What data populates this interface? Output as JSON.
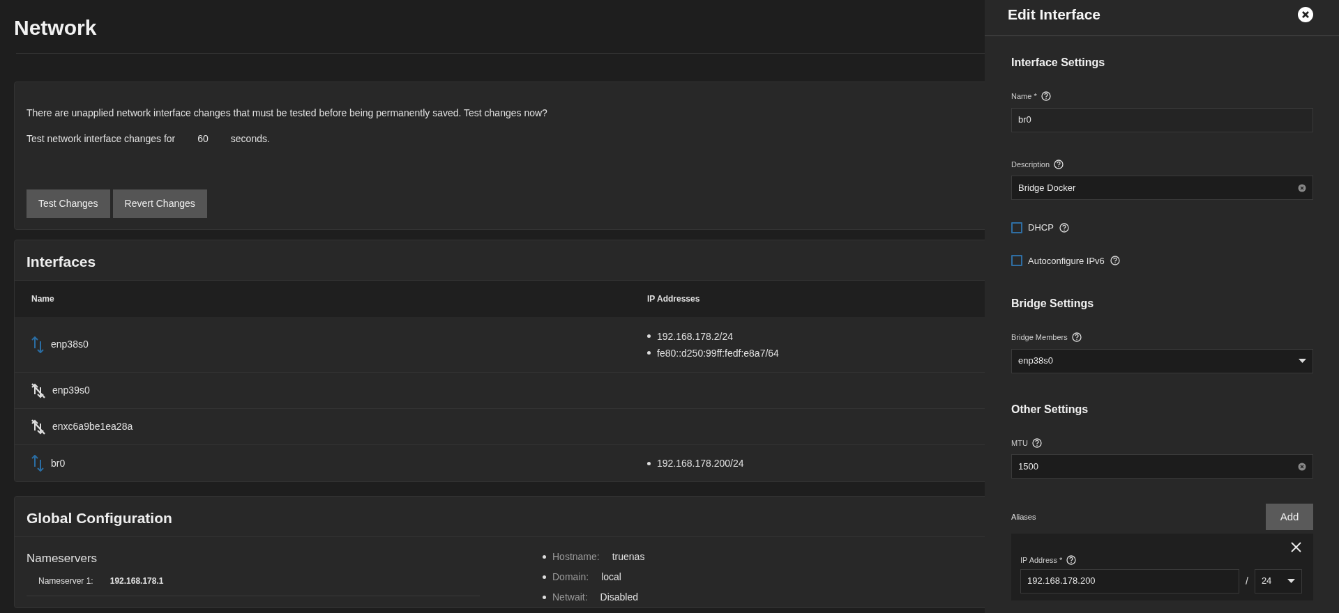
{
  "page": {
    "title": "Network"
  },
  "pending_changes": {
    "message": "There are unapplied network interface changes that must be tested before being permanently saved. Test changes now?",
    "test_prefix": "Test network interface changes for",
    "test_seconds": "60",
    "test_suffix": "seconds.",
    "buttons": [
      "Test Changes",
      "Revert Changes"
    ]
  },
  "interfaces": {
    "title": "Interfaces",
    "columns": [
      "Name",
      "IP Addresses"
    ],
    "rows": [
      {
        "name": "enp38s0",
        "link_up": true,
        "ip_addresses": [
          "192.168.178.2/24",
          "fe80::d250:99ff:fedf:e8a7/64"
        ]
      },
      {
        "name": "enp39s0",
        "link_up": false,
        "ip_addresses": []
      },
      {
        "name": "enxc6a9be1ea28a",
        "link_up": false,
        "ip_addresses": []
      },
      {
        "name": "br0",
        "link_up": true,
        "ip_addresses": [
          "192.168.178.200/24"
        ]
      }
    ]
  },
  "global_configuration": {
    "title": "Global Configuration",
    "nameservers": {
      "title": "Nameservers",
      "items": [
        {
          "label": "Nameserver 1:",
          "value": "192.168.178.1"
        }
      ]
    },
    "settings": [
      {
        "label": "Hostname:",
        "value": "truenas"
      },
      {
        "label": "Domain:",
        "value": "local"
      },
      {
        "label": "Netwait:",
        "value": "Disabled"
      }
    ]
  },
  "edit_panel": {
    "title": "Edit Interface",
    "sections": [
      {
        "title": "Interface Settings",
        "fields": [
          {
            "kind": "text",
            "label": "Name *",
            "value": "br0",
            "clearable": false
          },
          {
            "kind": "text",
            "label": "Description",
            "value": "Bridge Docker",
            "clearable": true
          },
          {
            "kind": "checkbox",
            "label": "DHCP",
            "checked": false
          },
          {
            "kind": "checkbox",
            "label": "Autoconfigure IPv6",
            "checked": false
          }
        ]
      },
      {
        "title": "Bridge Settings",
        "fields": [
          {
            "kind": "select",
            "label": "Bridge Members",
            "value": "enp38s0"
          }
        ]
      },
      {
        "title": "Other Settings",
        "fields": [
          {
            "kind": "text",
            "label": "MTU",
            "value": "1500",
            "clearable": true
          }
        ]
      }
    ],
    "aliases": {
      "label": "Aliases",
      "add_button": "Add",
      "items": [
        {
          "label": "IP Address *",
          "address": "192.168.178.200",
          "separator": "/",
          "netmask": "24"
        }
      ]
    }
  }
}
